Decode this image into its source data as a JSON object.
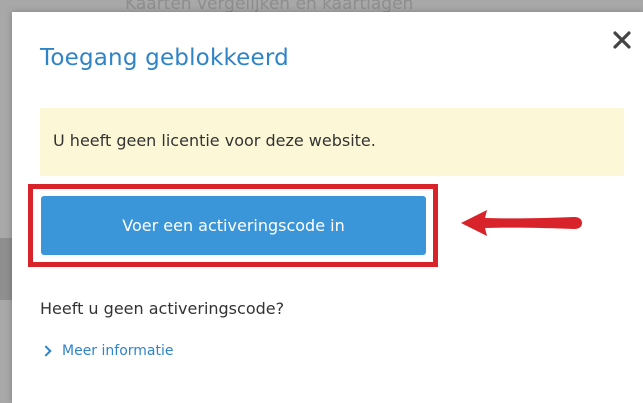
{
  "background": {
    "partial_heading": "Kaarten vergelijken en kaartlagen"
  },
  "dialog": {
    "title": "Toegang geblokkeerd",
    "close_glyph": "✕",
    "notice_text": "U heeft geen licentie voor deze website.",
    "primary_button_label": "Voer een activeringscode in",
    "question_text": "Heeft u geen activeringscode?",
    "more_info_label": "Meer informatie"
  },
  "colors": {
    "accent": "#2f84c8",
    "button": "#3b96d9",
    "notice_bg": "#fcf8d7",
    "annotation_red": "#d9232a"
  }
}
